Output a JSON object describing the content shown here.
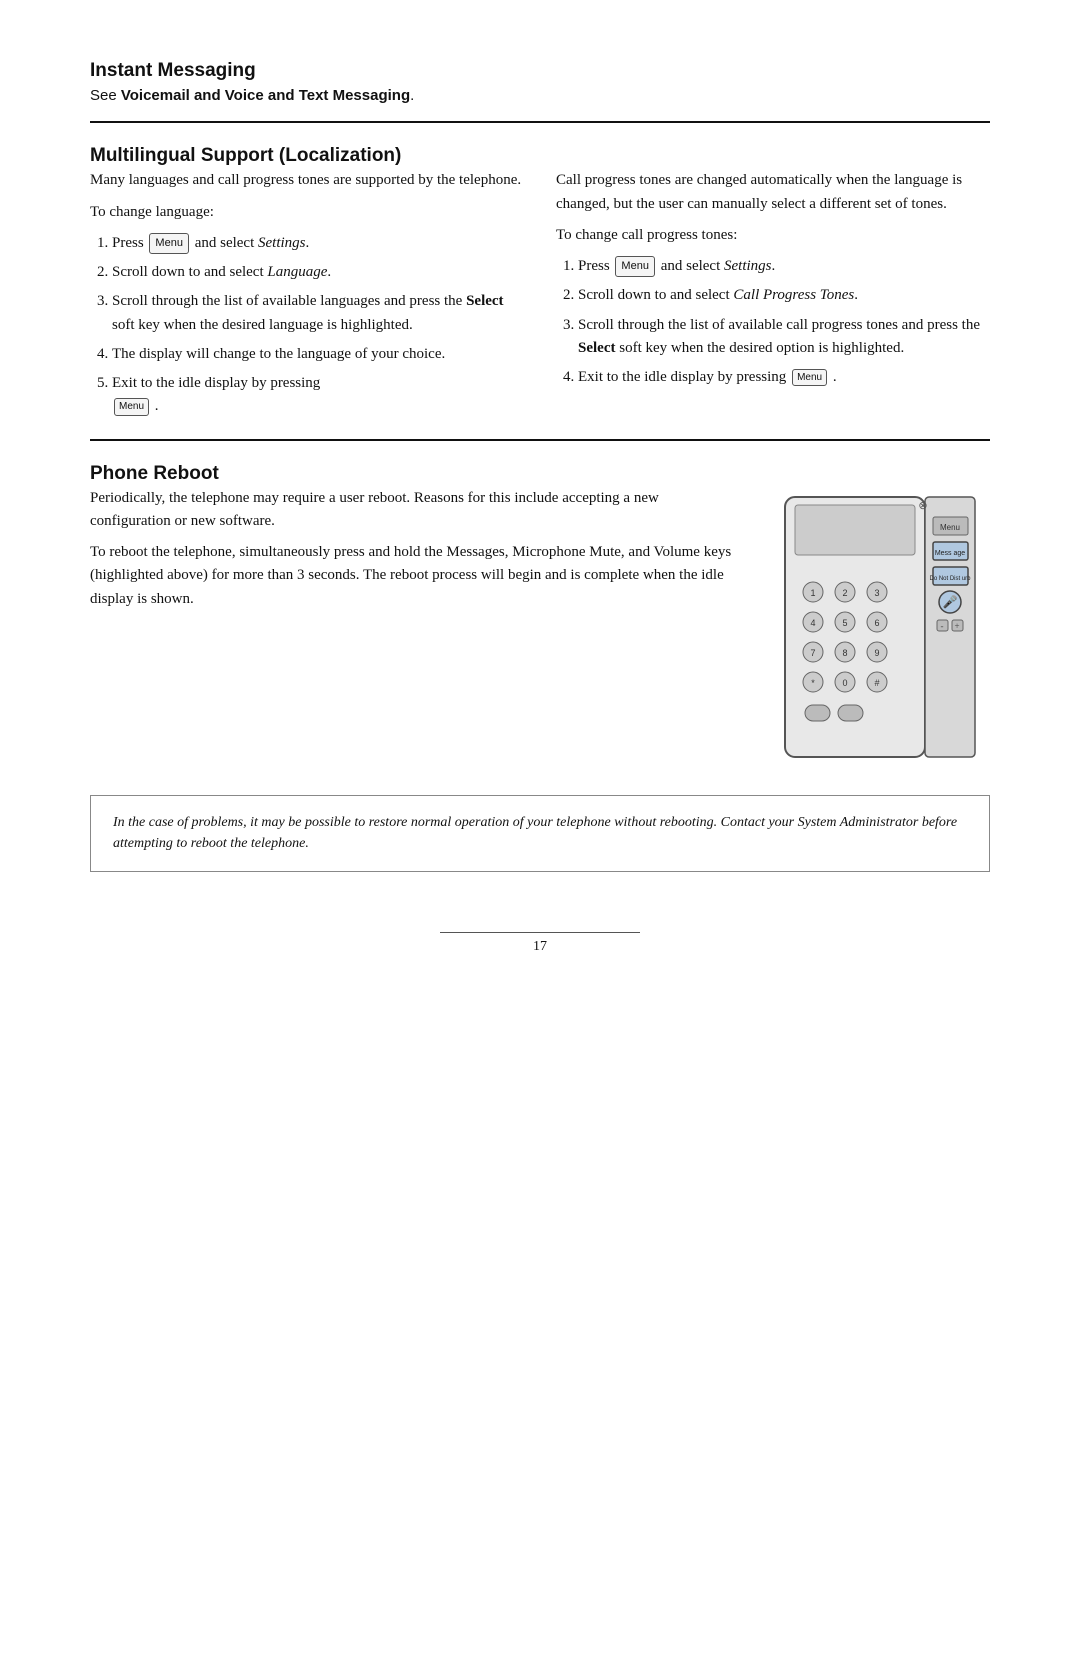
{
  "instant_messaging": {
    "title": "Instant Messaging",
    "subtitle_prefix": "See ",
    "subtitle_bold": "Voicemail and Voice and Text Messaging",
    "subtitle_suffix": "."
  },
  "multilingual": {
    "title": "Multilingual Support (Localization)",
    "left_col": {
      "intro": "Many languages and call progress tones are supported by the telephone.",
      "change_language_label": "To change language:",
      "steps": [
        "Press  Menu  and select Settings.",
        "Scroll down to and select Language.",
        "Scroll through the list of available languages and press the Select soft key when the desired language is highlighted.",
        "The display will change to the language of your choice.",
        "Exit to the idle display by pressing  Menu ."
      ]
    },
    "right_col": {
      "intro": "Call progress tones are changed automatically when the language is changed, but the user can manually select a different set of tones.",
      "change_tones_label": "To change call progress tones:",
      "steps": [
        "Press  Menu  and select Settings.",
        "Scroll down to and select Call Progress Tones.",
        "Scroll through the list of available call progress tones and press the Select soft key when the desired option is highlighted.",
        "Exit to the idle display by pressing  Menu ."
      ]
    }
  },
  "phone_reboot": {
    "title": "Phone Reboot",
    "para1": "Periodically, the telephone may require a user reboot.  Reasons for this include accepting a new configuration or new software.",
    "para2": "To reboot the telephone, simultaneously press and hold the Messages, Microphone Mute, and Volume keys (highlighted above) for more than 3 seconds.  The reboot process will begin and is complete when the idle display is shown.",
    "note": "In the case of problems, it may be possible to restore normal operation of your telephone without rebooting.  Contact your System Administrator before attempting to reboot the telephone."
  },
  "footer": {
    "page_number": "17"
  }
}
